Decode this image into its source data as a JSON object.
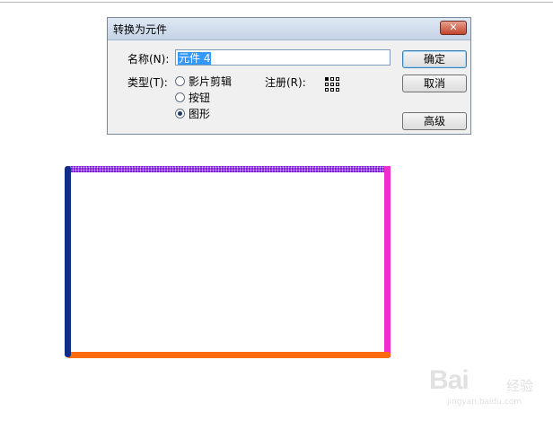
{
  "dialog": {
    "title": "转换为元件",
    "close_label": "✕",
    "name_label": "名称(N):",
    "name_value": "元件 4",
    "type_label": "类型(T):",
    "types": [
      {
        "label": "影片剪辑",
        "checked": false
      },
      {
        "label": "按钮",
        "checked": false
      },
      {
        "label": "图形",
        "checked": true
      }
    ],
    "registration_label": "注册(R):",
    "registration_point": "top-left",
    "buttons": {
      "ok": "确定",
      "cancel": "取消",
      "advanced": "高级"
    }
  },
  "stage": {
    "rectangle": {
      "stroke_colors": {
        "top": "#7a1fd6",
        "right": "#f02fc8",
        "bottom": "#ff6a0e",
        "left": "#0f2e8c"
      },
      "fill_color": "#ffffff"
    }
  },
  "watermark": {
    "brand": "Bai",
    "brand_suffix": "经验",
    "url": "jingyan.baidu.com"
  }
}
